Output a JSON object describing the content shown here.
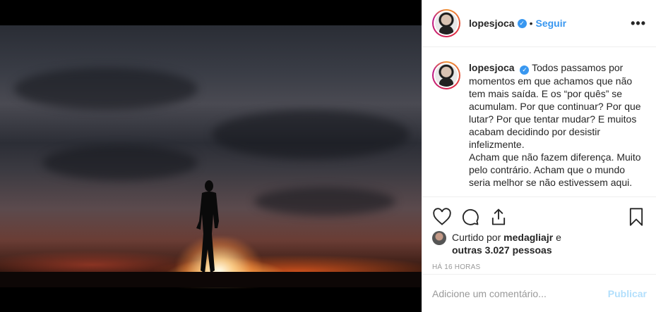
{
  "post": {
    "username": "lopesjoca",
    "follow_label": "Seguir",
    "more_label": "•••",
    "caption_text": "Todos passamos por momentos em que achamos que não tem mais saída. E os “por quês” se acumulam. Por que continuar? Por que lutar? Por que tentar mudar? E muitos acabam decidindo por desistir infelizmente.",
    "caption_text_2": "Acham que não fazem diferença. Muito pelo contrário. Acham que o mundo seria melhor se não estivessem aqui.",
    "likes_prefix": "Curtido por",
    "likes_user": "medagliajr",
    "likes_connector": "e",
    "likes_others": "outras 3.027 pessoas",
    "timestamp": "Há 16 horas"
  },
  "comment": {
    "placeholder": "Adicione um comentário...",
    "publish_label": "Publicar"
  },
  "colors": {
    "accent": "#3897f0",
    "publish_disabled": "#b2dffc"
  }
}
